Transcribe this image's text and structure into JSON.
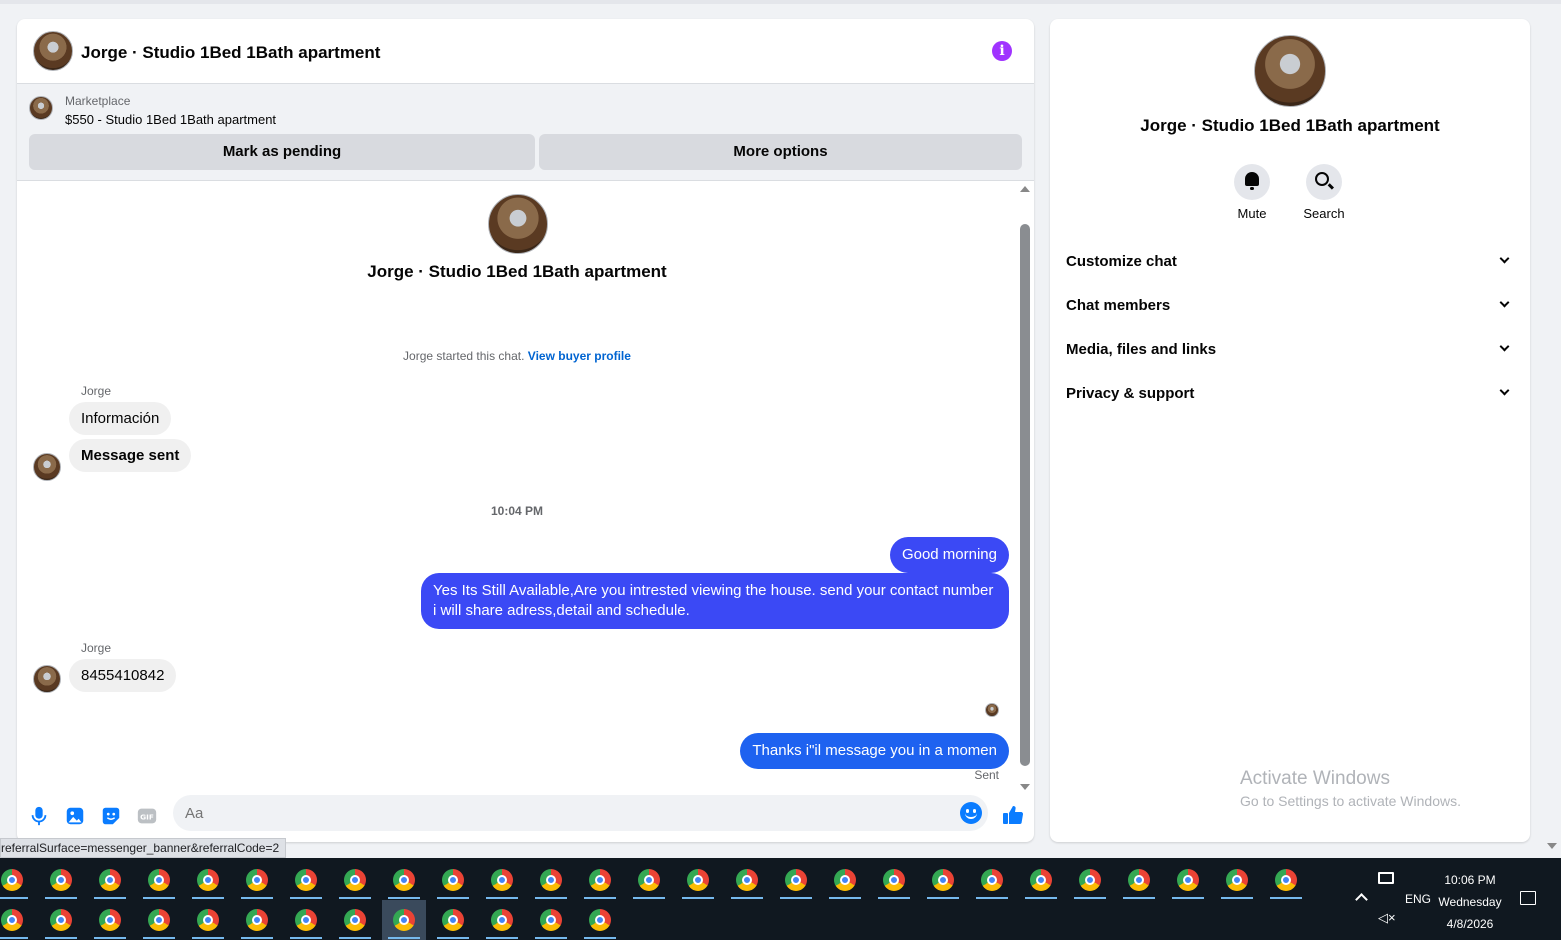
{
  "chat": {
    "title": "Jorge · Studio 1Bed 1Bath apartment",
    "info_icon": "info-icon",
    "marketplace": {
      "label": "Marketplace",
      "item": "$550 - Studio 1Bed 1Bath apartment",
      "mark_pending": "Mark as pending",
      "more_options": "More options"
    },
    "intro_title": "Jorge · Studio 1Bed 1Bath apartment",
    "started_text": "Jorge started this chat.",
    "view_profile": "View buyer profile",
    "messages": [
      {
        "sender": "Jorge",
        "text": "Información"
      },
      {
        "text": "Message sent"
      },
      {
        "timestamp": "10:04 PM"
      },
      {
        "text": "Good morning"
      },
      {
        "text": "Yes Its Still Available,Are you intrested viewing the house. send your contact number i will share adress,detail and schedule."
      },
      {
        "sender": "Jorge",
        "text": "8455410842"
      },
      {
        "text": "Thanks i\"il message you in a momen"
      }
    ],
    "sent_label": "Sent",
    "composer_placeholder": "Aa"
  },
  "info_panel": {
    "title": "Jorge · Studio 1Bed 1Bath apartment",
    "actions": [
      {
        "label": "Mute",
        "icon": "bell-icon"
      },
      {
        "label": "Search",
        "icon": "search-icon"
      }
    ],
    "sections": [
      "Customize chat",
      "Chat members",
      "Media, files and links",
      "Privacy & support"
    ]
  },
  "watermark": {
    "line1": "Activate Windows",
    "line2": "Go to Settings to activate Windows."
  },
  "status_url": "referralSurface=messenger_banner&referralCode=2",
  "taskbar": {
    "row1_count": 27,
    "row2_count": 13,
    "lang": "ENG",
    "time": "10:06 PM",
    "day": "Wednesday",
    "date": "4/8/2026"
  },
  "colors": {
    "outgoing_bubble": "#3b49f5",
    "accent": "#0a7cff",
    "info_purple": "#a033ff"
  }
}
